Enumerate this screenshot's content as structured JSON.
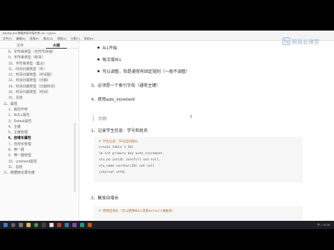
{
  "window": {
    "title": "[MySQL]04-数据库表字段约束.md - Typora",
    "menu": [
      "文件(F)",
      "编辑(E)",
      "段落(P)",
      "格式(O)",
      "视图(V)",
      "主题(T)",
      "帮助(H)"
    ]
  },
  "sidebar": {
    "tab_files": "文件",
    "tab_outline": "大纲",
    "items": [
      {
        "label": "8、字符串类型（无符号存储）",
        "level": 2
      },
      {
        "label": "9、字符串类型（枚举）",
        "level": 2
      },
      {
        "label": "10、字符串类型（集合）",
        "level": 2
      },
      {
        "label": "11、时间日期类型（年）",
        "level": 2
      },
      {
        "label": "12、时间日期类型（时间戳）",
        "level": 2
      },
      {
        "label": "13、时间日期类型（日期）",
        "level": 2
      },
      {
        "label": "14、时间日期类型（日期时间）",
        "level": 2
      },
      {
        "label": "15、时间日期类型（时间）",
        "level": 2
      },
      {
        "label": "16、总结",
        "level": 2
      },
      {
        "label": "三、属性",
        "level": 1
      },
      {
        "label": "1、属性作用",
        "level": 2
      },
      {
        "label": "2、NULL属性",
        "level": 2
      },
      {
        "label": "3、Default属性",
        "level": 2
      },
      {
        "label": "4、主键",
        "level": 2
      },
      {
        "label": "5、主键管理",
        "level": 2
      },
      {
        "label": "6、自增长属性",
        "level": 2,
        "active": true
      },
      {
        "label": "7、自增长管理",
        "level": 2
      },
      {
        "label": "8、唯一键",
        "level": 2
      },
      {
        "label": "9、唯一键管理",
        "level": 2
      },
      {
        "label": "10、comment属性",
        "level": 2
      },
      {
        "label": "11、总结",
        "level": 2
      },
      {
        "label": "三、数据库记录长度",
        "level": 1
      }
    ]
  },
  "content": {
    "bullet1": "从1开始",
    "bullet2": "每次增长1",
    "bullet3": "可以调整，但是通常有固定规则（一般不调整）",
    "item3": "3、必须是一个索引字段（通常主键）",
    "item4": "4、使用auto_increment",
    "example_label": "示例",
    "step1": "1、记录学生信息：学号和姓名",
    "code1": [
      "# 学生信息：学号自动增长",
      "create table t_20(",
      "    id int primary key auto_increment,",
      "    stu_no int(8) zerofill not null,",
      "    stu_name varchar(20) not null",
      ")charset utf8;"
    ],
    "step2": "2、触发自增长",
    "code2_line": "# 使用自增长（可以使用NULL或者default来触发）"
  },
  "brand": {
    "text": "网易云课堂"
  },
  "taskbar": {
    "tray": "中 ♪ 10:36"
  }
}
